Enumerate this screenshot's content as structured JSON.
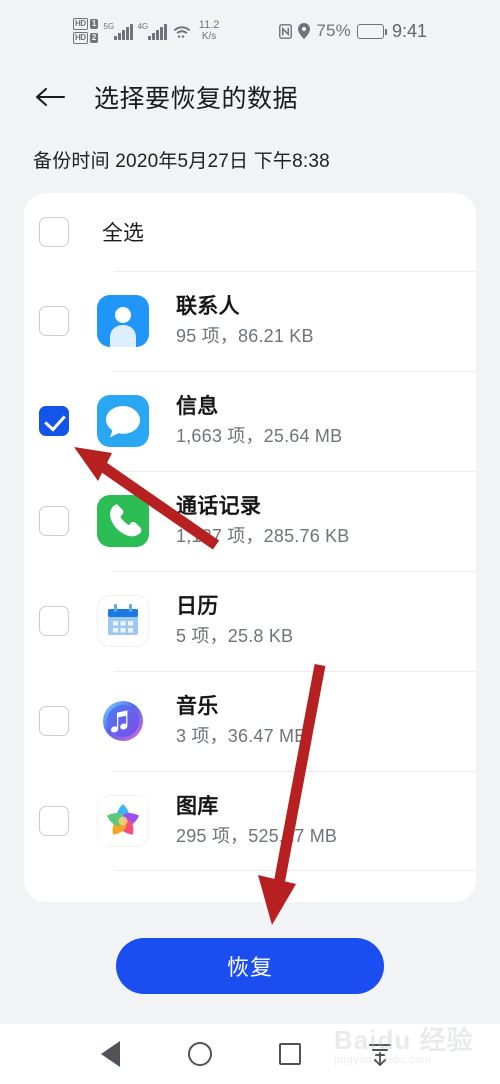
{
  "status_bar": {
    "hd_badges": [
      "HD",
      "HD"
    ],
    "sim_badges": [
      "1",
      "2"
    ],
    "network_labels": [
      "5G",
      "4G"
    ],
    "data_speed_value": "11.2",
    "data_speed_unit": "K/s",
    "nfc_icon": "nfc-icon",
    "location_icon": "location-icon",
    "battery_percent": "75%",
    "clock": "9:41"
  },
  "header": {
    "back_icon": "back-arrow-icon",
    "title": "选择要恢复的数据"
  },
  "backup_time": "备份时间 2020年5月27日 下午8:38",
  "select_all": {
    "label": "全选",
    "checked": false
  },
  "list": {
    "items": [
      {
        "name": "联系人",
        "meta": "95 项，86.21 KB",
        "checked": false,
        "icon": "contacts-icon"
      },
      {
        "name": "信息",
        "meta": "1,663 项，25.64 MB",
        "checked": true,
        "icon": "messages-icon"
      },
      {
        "name": "通话记录",
        "meta": "1,127 项，285.76 KB",
        "checked": false,
        "icon": "phone-icon"
      },
      {
        "name": "日历",
        "meta": "5 项，25.8 KB",
        "checked": false,
        "icon": "calendar-icon"
      },
      {
        "name": "音乐",
        "meta": "3 项，36.47 MB",
        "checked": false,
        "icon": "music-icon"
      },
      {
        "name": "图库",
        "meta": "295 项，525.17 MB",
        "checked": false,
        "icon": "gallery-icon"
      }
    ]
  },
  "restore_button": {
    "label": "恢复"
  },
  "nav_bar": {
    "back_icon": "nav-back-triangle-icon",
    "home_icon": "nav-home-circle-icon",
    "recents_icon": "nav-recents-square-icon",
    "download_icon": "download-icon"
  },
  "watermark": {
    "text": "Baidu 经验",
    "sub": "jingyan.baidu.com"
  },
  "colors": {
    "accent_blue": "#1a4ef0",
    "checkbox_blue": "#1355e8",
    "page_bg": "#f1f3f4",
    "card_bg": "#ffffff",
    "annotation_red": "#b62020"
  }
}
